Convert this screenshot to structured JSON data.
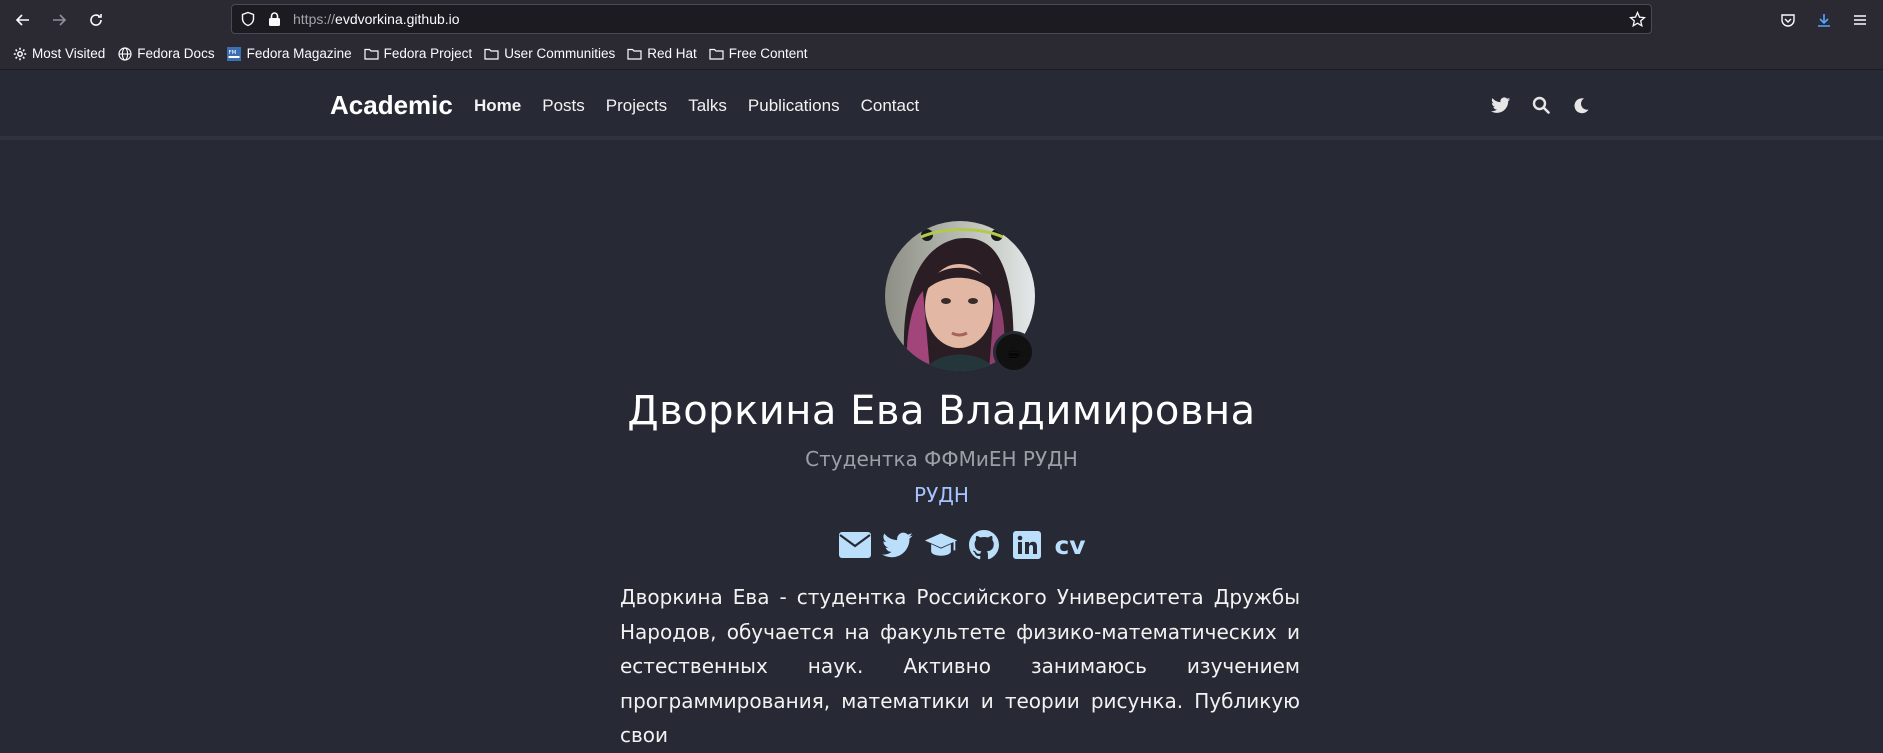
{
  "browser": {
    "url_protocol": "https://",
    "url_host": "evdvorkina.github.io",
    "bookmarks": [
      {
        "label": "Most Visited",
        "icon": "gear-icon"
      },
      {
        "label": "Fedora Docs",
        "icon": "globe-icon"
      },
      {
        "label": "Fedora Magazine",
        "icon": "fm-favicon-icon"
      },
      {
        "label": "Fedora Project",
        "icon": "folder-icon"
      },
      {
        "label": "User Communities",
        "icon": "folder-icon"
      },
      {
        "label": "Red Hat",
        "icon": "folder-icon"
      },
      {
        "label": "Free Content",
        "icon": "folder-icon"
      }
    ]
  },
  "site": {
    "brand": "Academic",
    "nav": [
      "Home",
      "Posts",
      "Projects",
      "Talks",
      "Publications",
      "Contact"
    ],
    "active_nav": "Home"
  },
  "profile": {
    "name": "Дворкина Ева Владимировна",
    "role": "Студентка ФФМиЕН РУДН",
    "organization": "РУДН",
    "badge_emoji": "☕",
    "cv_label": "cv",
    "bio": "Дворкина Ева - студентка Российского Университета Дружбы Народов, обучается на факультете физико-математических и естественных наук. Активно занимаюсь изучением программирования, математики и теории рисунка. Публикую свои"
  },
  "colors": {
    "page_bg": "#272a35",
    "accent": "#bbdefb",
    "org_link": "#a7c4ff"
  }
}
